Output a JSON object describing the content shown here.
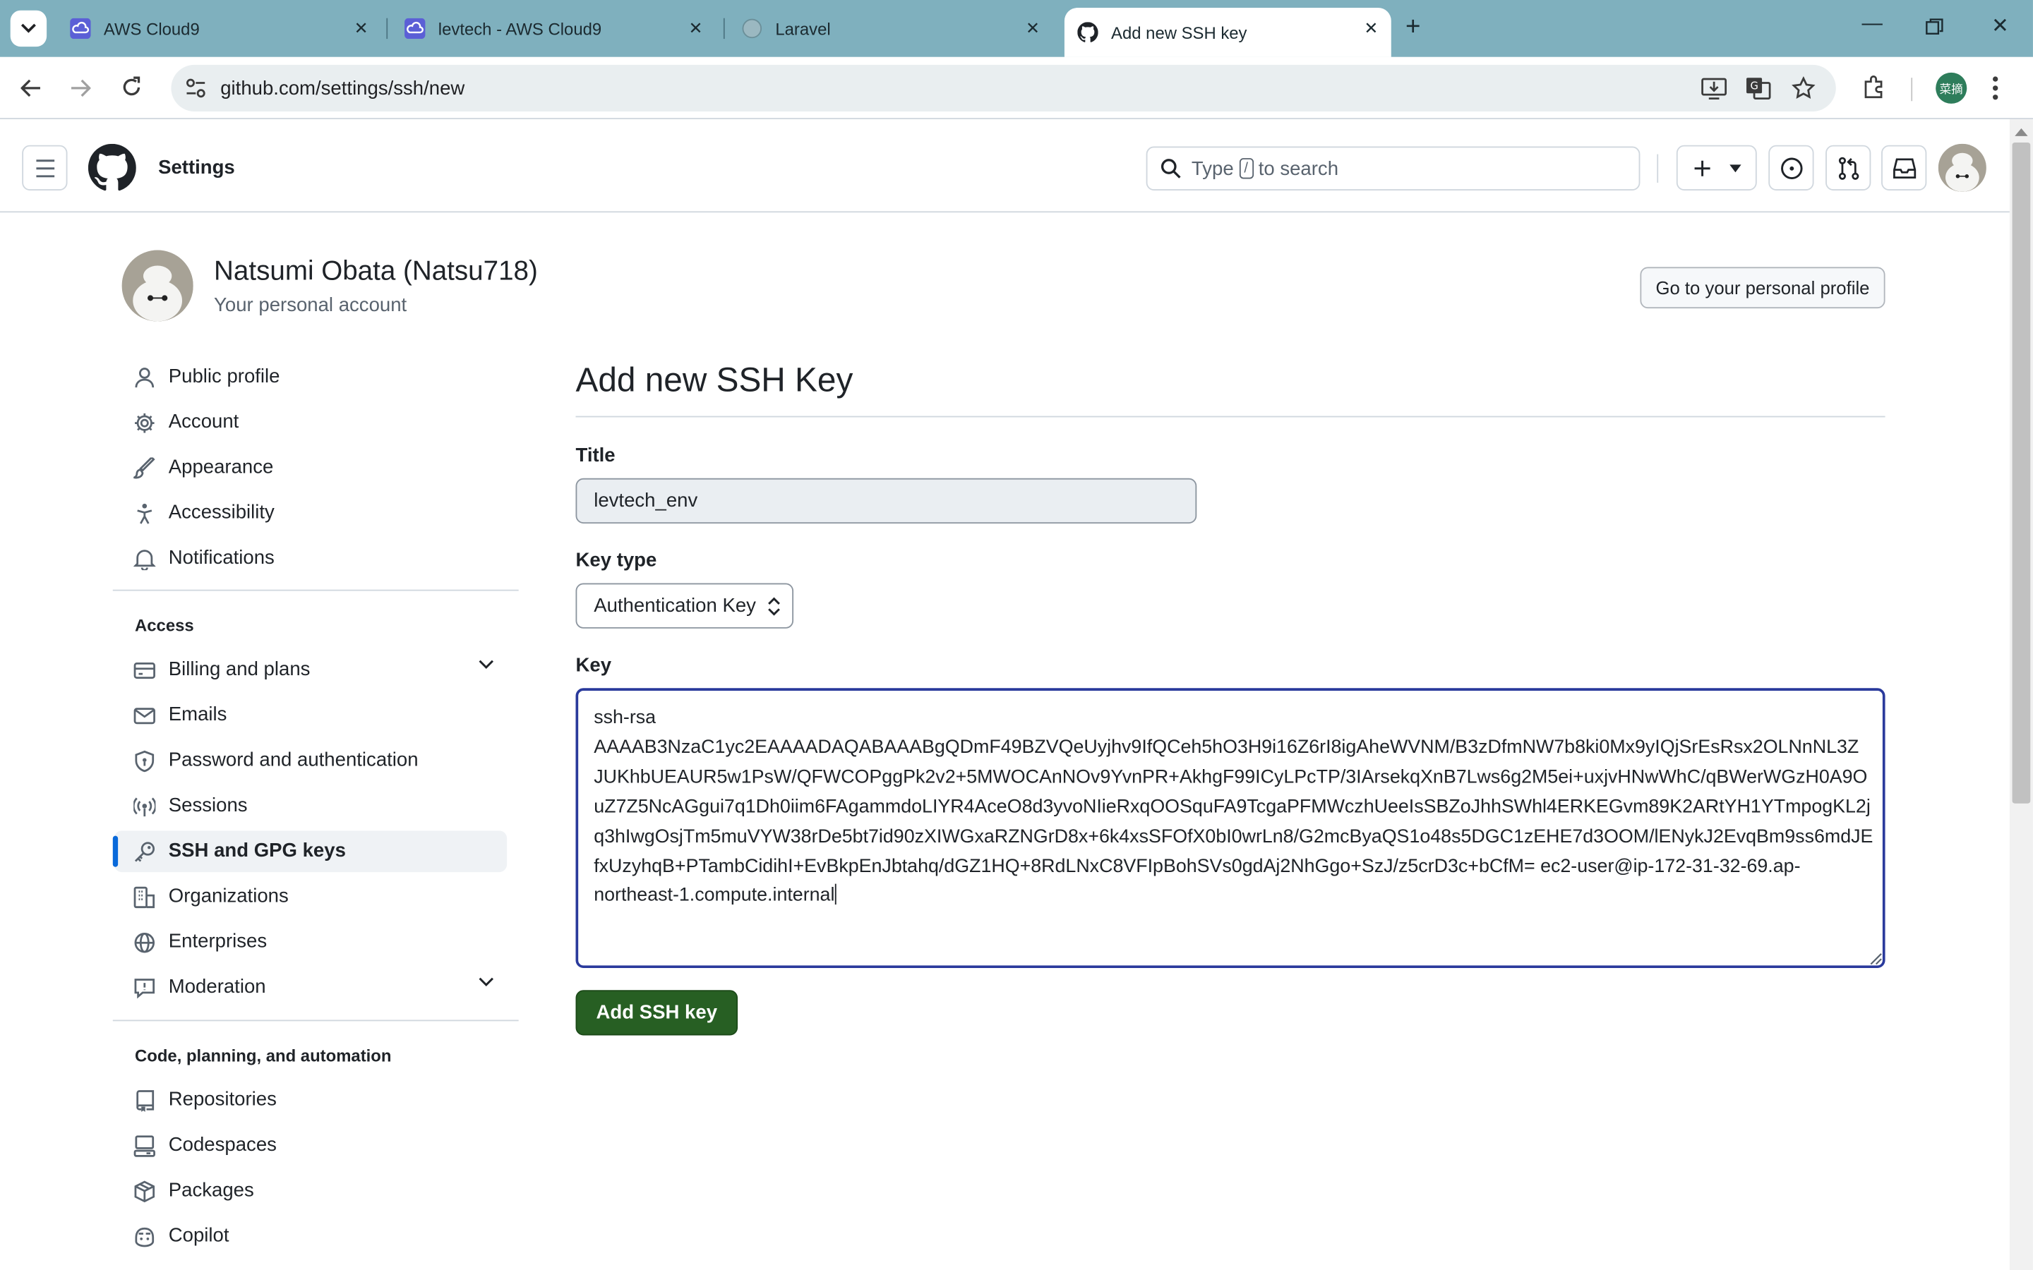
{
  "browser": {
    "tabs": [
      {
        "label": "AWS Cloud9",
        "icon": "cloud9-icon"
      },
      {
        "label": "levtech - AWS Cloud9",
        "icon": "cloud9-icon"
      },
      {
        "label": "Laravel",
        "icon": "globe-icon"
      },
      {
        "label": "Add new SSH key",
        "icon": "github-icon",
        "active": true
      }
    ],
    "url": "github.com/settings/ssh/new",
    "profile_badge": "菜摘"
  },
  "header": {
    "title": "Settings",
    "search_prefix": "Type",
    "search_key": "/",
    "search_suffix": "to search"
  },
  "profile": {
    "name": "Natsumi Obata (Natsu718)",
    "subtitle": "Your personal account",
    "button": "Go to your personal profile"
  },
  "sidebar": {
    "items_top": [
      {
        "label": "Public profile",
        "icon": "person-icon"
      },
      {
        "label": "Account",
        "icon": "gear-icon"
      },
      {
        "label": "Appearance",
        "icon": "paintbrush-icon"
      },
      {
        "label": "Accessibility",
        "icon": "accessibility-icon"
      },
      {
        "label": "Notifications",
        "icon": "bell-icon"
      }
    ],
    "access_heading": "Access",
    "items_access": [
      {
        "label": "Billing and plans",
        "icon": "credit-card-icon",
        "expandable": true
      },
      {
        "label": "Emails",
        "icon": "mail-icon"
      },
      {
        "label": "Password and authentication",
        "icon": "shield-lock-icon"
      },
      {
        "label": "Sessions",
        "icon": "broadcast-icon"
      },
      {
        "label": "SSH and GPG keys",
        "icon": "key-icon",
        "selected": true
      },
      {
        "label": "Organizations",
        "icon": "organization-icon"
      },
      {
        "label": "Enterprises",
        "icon": "globe-icon"
      },
      {
        "label": "Moderation",
        "icon": "report-icon",
        "expandable": true
      }
    ],
    "code_heading": "Code, planning, and automation",
    "items_code": [
      {
        "label": "Repositories",
        "icon": "repo-icon"
      },
      {
        "label": "Codespaces",
        "icon": "codespaces-icon"
      },
      {
        "label": "Packages",
        "icon": "package-icon"
      },
      {
        "label": "Copilot",
        "icon": "copilot-icon"
      }
    ]
  },
  "main": {
    "heading": "Add new SSH Key",
    "title_label": "Title",
    "title_value": "levtech_env",
    "keytype_label": "Key type",
    "keytype_value": "Authentication Key",
    "key_label": "Key",
    "key_lines": [
      "ssh-rsa",
      "AAAAB3NzaC1yc2EAAAADAQABAAABgQDmF49BZVQeUyjhv9IfQCeh5hO3H9i16Z6rI8igAheWVNM/B3zDfmNW7b8ki0Mx9yIQjSrEsRsx2OLNnNL3Z",
      "JUKhbUEAUR5w1PsW/QFWCOPggPk2v2+5MWOCAnNOv9YvnPR+AkhgF99ICyLPcTP/3IArsekqXnB7Lws6g2M5ei+uxjvHNwWhC/qBWerWGzH0A9O",
      "uZ7Z5NcAGgui7q1Dh0iim6FAgammdoLIYR4AceO8d3yvoNIieRxqOOSquFA9TcgaPFMWczhUeeIsSBZoJhhSWhl4ERKEGvm89K2ARtYH1YTmpogKL2j",
      "q3hIwgOsjTm5muVYW38rDe5bt7id90zXIWGxaRZNGrD8x+6k4xsSFOfX0bI0wrLn8/G2mcByaQS1o48s5DGC1zEHE7d3OOM/lENykJ2EvqBm9ss6mdJE",
      "fxUzyhqB+PTambCidihI+EvBkpEnJbtahq/dGZ1HQ+8RdLNxC8VFIpBohSVs0gdAj2NhGgo+SzJ/z5crD3c+bCfM= ec2-user@ip-172-31-32-69.ap-",
      "northeast-1.compute.internal"
    ],
    "submit": "Add SSH key"
  },
  "colors": {
    "tabbar": "#7fb0be",
    "submit": "#275f23",
    "focus_border": "#2a3a9c",
    "selected_bar": "#0969da"
  }
}
